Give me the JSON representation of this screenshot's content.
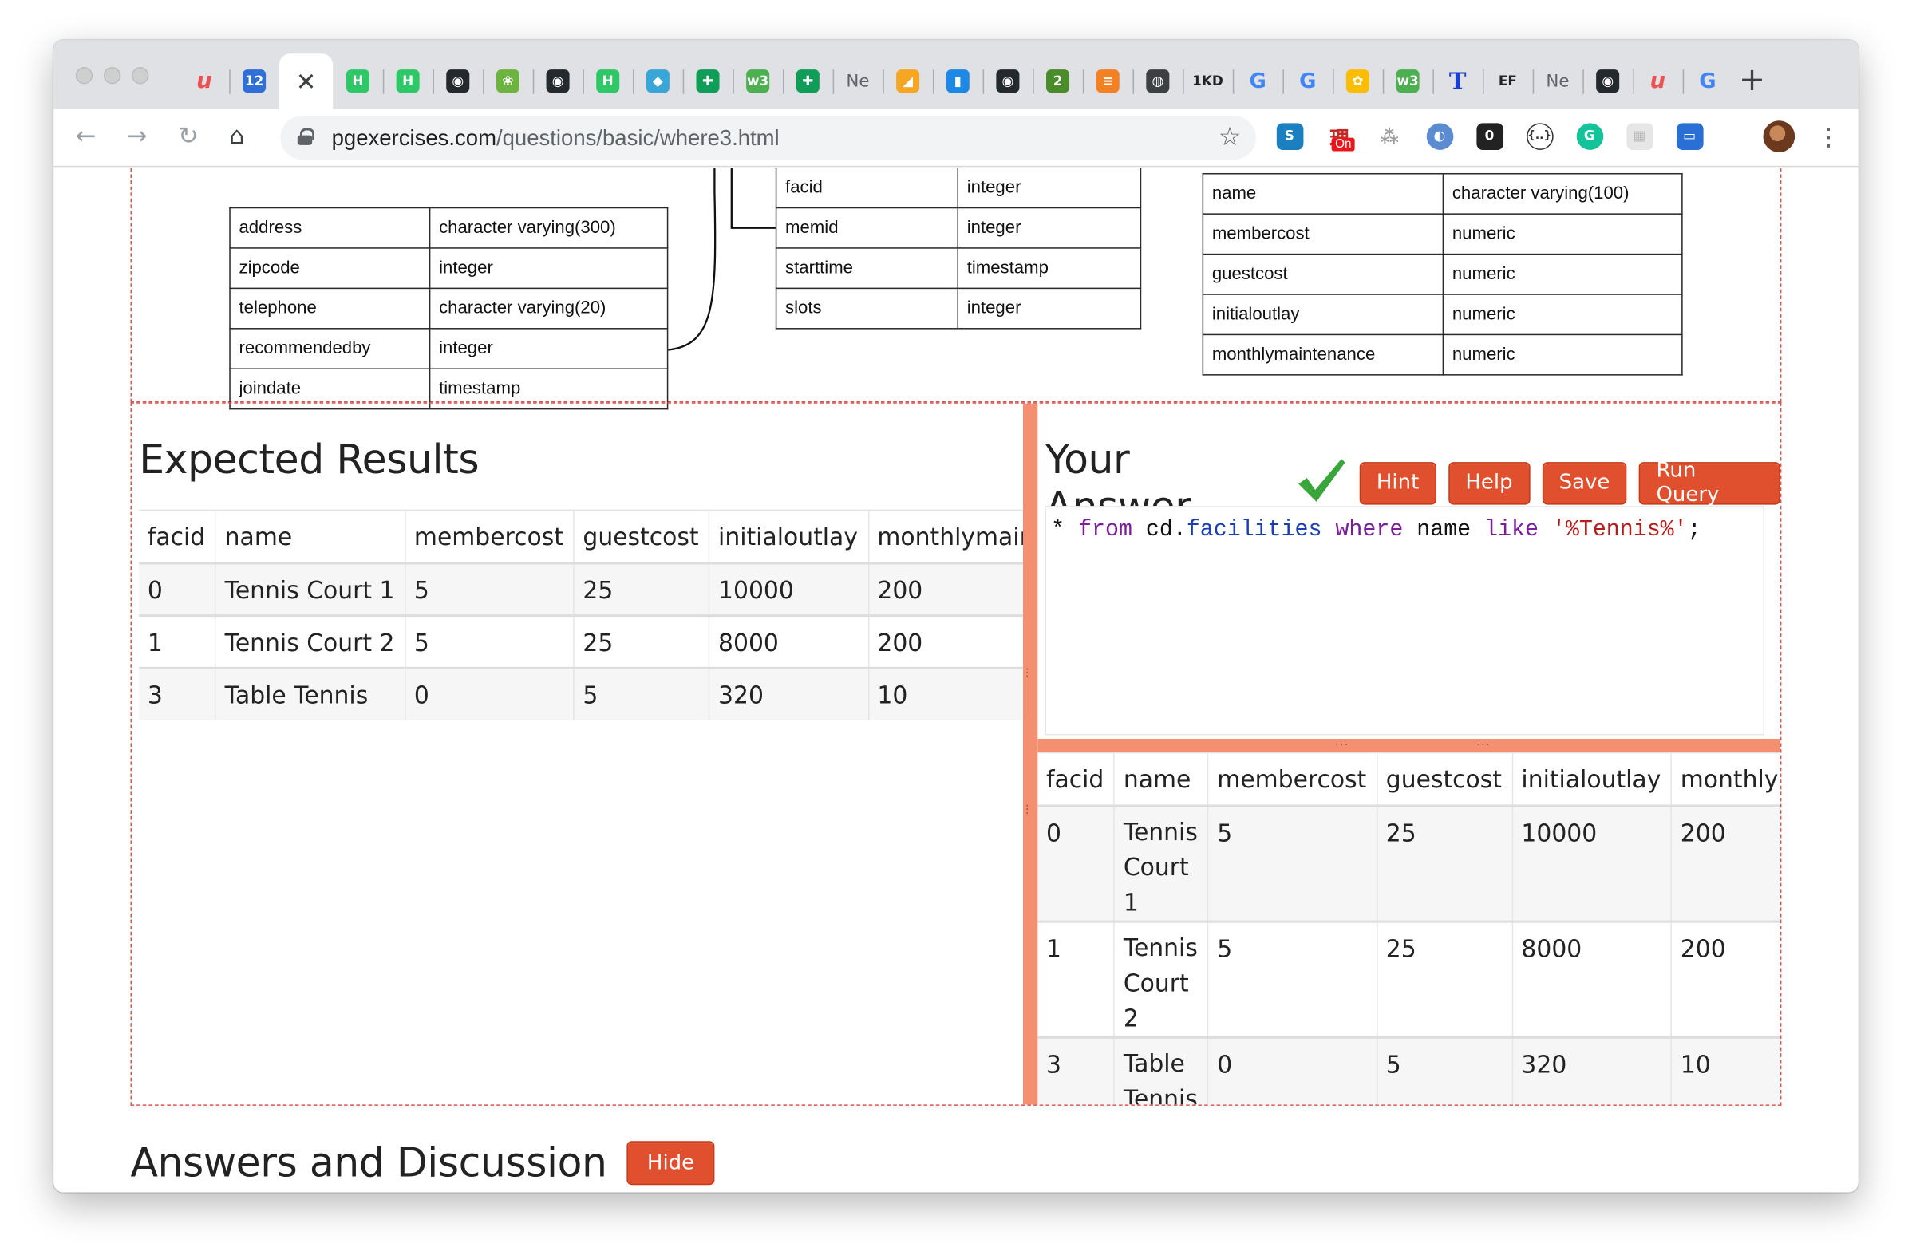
{
  "browser": {
    "tabs": [
      {
        "icon": "udemy-icon",
        "glyph": "u",
        "color": "#ec5252",
        "text": true
      },
      {
        "icon": "calendar-icon",
        "glyph": "12",
        "color": "#2f6fd6"
      },
      {
        "icon": "close-icon",
        "glyph": "✕",
        "active": true
      },
      {
        "icon": "hackerrank-icon",
        "glyph": "H",
        "color": "#2ec866"
      },
      {
        "icon": "hackerrank-icon",
        "glyph": "H",
        "color": "#2ec866"
      },
      {
        "icon": "github-icon",
        "glyph": "◉",
        "color": "#24292e"
      },
      {
        "icon": "spring-icon",
        "glyph": "❀",
        "color": "#6db33f"
      },
      {
        "icon": "github-icon",
        "glyph": "◉",
        "color": "#24292e"
      },
      {
        "icon": "hackerrank-icon",
        "glyph": "H",
        "color": "#2ec866"
      },
      {
        "icon": "bird-icon",
        "glyph": "◆",
        "color": "#3aa6d8"
      },
      {
        "icon": "sheets-icon",
        "glyph": "✚",
        "color": "#0f9d58"
      },
      {
        "icon": "w3schools-icon",
        "glyph": "w3",
        "color": "#4caf50"
      },
      {
        "icon": "sheets-icon",
        "glyph": "✚",
        "color": "#0f9d58"
      },
      {
        "icon": "text-tab-icon",
        "glyph": "Ne",
        "text": true
      },
      {
        "icon": "cheese-icon",
        "glyph": "◢",
        "color": "#f5a623"
      },
      {
        "icon": "database-icon",
        "glyph": "▮",
        "color": "#1e88e5"
      },
      {
        "icon": "github-icon",
        "glyph": "◉",
        "color": "#24292e"
      },
      {
        "icon": "script-icon",
        "glyph": "2",
        "color": "#4a8c2a"
      },
      {
        "icon": "stackoverflow-icon",
        "glyph": "≡",
        "color": "#f48024"
      },
      {
        "icon": "globe-icon",
        "glyph": "◍",
        "color": "#3c4043"
      },
      {
        "icon": "1kd-icon",
        "glyph": "1KD",
        "text": true
      },
      {
        "icon": "google-icon",
        "glyph": "G",
        "color": "#4285f4",
        "text": true
      },
      {
        "icon": "google-icon",
        "glyph": "G",
        "color": "#4285f4",
        "text": true
      },
      {
        "icon": "palette-icon",
        "glyph": "✿",
        "color": "#fbbc04"
      },
      {
        "icon": "w3schools-icon",
        "glyph": "w3",
        "color": "#4caf50"
      },
      {
        "icon": "t-icon",
        "glyph": "T",
        "text": true
      },
      {
        "icon": "ef-icon",
        "glyph": "EF",
        "text": true
      },
      {
        "icon": "text-tab-icon",
        "glyph": "Ne",
        "text": true
      },
      {
        "icon": "github-icon",
        "glyph": "◉",
        "color": "#24292e"
      },
      {
        "icon": "udemy-icon",
        "glyph": "u",
        "color": "#ec5252",
        "text": true
      },
      {
        "icon": "google-icon",
        "glyph": "G",
        "color": "#4285f4",
        "text": true
      }
    ],
    "new_tab": "+",
    "url_domain": "pgexercises.com",
    "url_path": "/questions/basic/where3.html",
    "ext_badge": "On"
  },
  "schema": {
    "members_rows": [
      [
        "address",
        "character varying(300)"
      ],
      [
        "zipcode",
        "integer"
      ],
      [
        "telephone",
        "character varying(20)"
      ],
      [
        "recommendedby",
        "integer"
      ],
      [
        "joindate",
        "timestamp"
      ]
    ],
    "bookings_rows": [
      [
        "facid",
        "integer"
      ],
      [
        "memid",
        "integer"
      ],
      [
        "starttime",
        "timestamp"
      ],
      [
        "slots",
        "integer"
      ]
    ],
    "facilities_rows": [
      [
        "name",
        "character varying(100)"
      ],
      [
        "membercost",
        "numeric"
      ],
      [
        "guestcost",
        "numeric"
      ],
      [
        "initialoutlay",
        "numeric"
      ],
      [
        "monthlymaintenance",
        "numeric"
      ]
    ]
  },
  "expected": {
    "title": "Expected Results",
    "columns": [
      "facid",
      "name",
      "membercost",
      "guestcost",
      "initialoutlay",
      "monthlymaintenance"
    ],
    "rows": [
      [
        "0",
        "Tennis Court 1",
        "5",
        "25",
        "10000",
        "200"
      ],
      [
        "1",
        "Tennis Court 2",
        "5",
        "25",
        "8000",
        "200"
      ],
      [
        "3",
        "Table Tennis",
        "0",
        "5",
        "320",
        "10"
      ]
    ]
  },
  "answer": {
    "title": "Your Answer",
    "buttons": {
      "hint": "Hint",
      "help": "Help",
      "save": "Save",
      "run": "Run Query"
    },
    "code": {
      "p1": "* ",
      "kw1": "from",
      "p2": " cd.",
      "tbl": "facilities",
      "p3": " ",
      "kw2": "where",
      "p4": " name ",
      "kw3": "like",
      "p5": " ",
      "str": "'%Tennis%'",
      "p6": ";"
    },
    "results": {
      "columns": [
        "facid",
        "name",
        "membercost",
        "guestcost",
        "initialoutlay",
        "monthlymaintenance"
      ],
      "rows": [
        [
          "0",
          "Tennis Court 1",
          "5",
          "25",
          "10000",
          "200"
        ],
        [
          "1",
          "Tennis Court 2",
          "5",
          "25",
          "8000",
          "200"
        ],
        [
          "3",
          "Table Tennis",
          "0",
          "5",
          "320",
          "10"
        ]
      ]
    }
  },
  "discussion": {
    "title": "Answers and Discussion",
    "hide_label": "Hide"
  },
  "colors": {
    "accent_button": "#e1502e",
    "splitter": "#f4906f",
    "dashed_border": "#d9534f",
    "check": "#3aa53a"
  }
}
